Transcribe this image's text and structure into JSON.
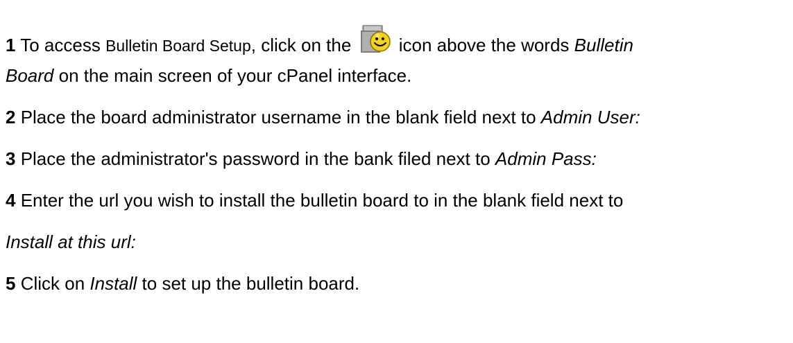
{
  "steps": [
    {
      "num": "1",
      "lines": [
        {
          "t1": " To access ",
          "t2": "Bulletin Board Setup",
          "t3": ", click on the ",
          "t4": " icon above the words ",
          "t5": "Bulletin"
        },
        {
          "t1": "Board",
          "t2": " on the main screen of your cPanel interface."
        }
      ],
      "icon": "bulletin-board-smiley-icon"
    },
    {
      "num": "2",
      "t1": " Place the board administrator username in the blank field next to ",
      "t2": "Admin User:"
    },
    {
      "num": "3",
      "t1": " Place the administrator's password in the bank filed next to ",
      "t2": "Admin Pass:"
    },
    {
      "num": "4",
      "lines": [
        {
          "t1": " Enter the url you wish to install the bulletin board to in the blank field next to"
        },
        {
          "t1": "Install at this url:"
        }
      ]
    },
    {
      "num": "5",
      "t1": " Click on ",
      "t2": "Install",
      "t3": " to set up the bulletin board."
    }
  ],
  "colors": {
    "text": "#000000",
    "icon_face": "#f3d21a",
    "icon_folder": "#8a8a8a"
  }
}
